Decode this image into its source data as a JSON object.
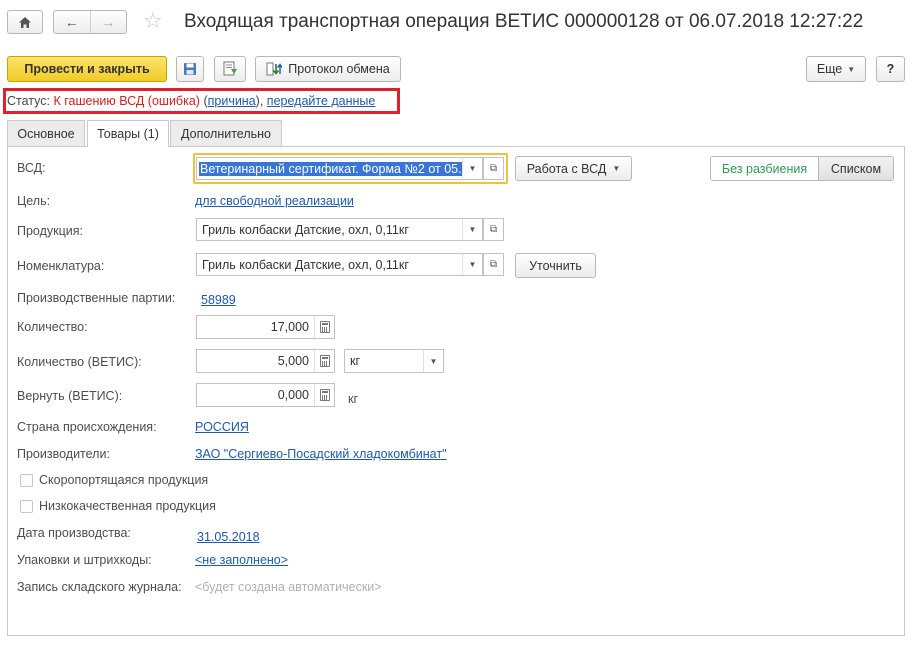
{
  "window": {
    "title": "Входящая транспортная операция ВЕТИС 000000128 от 06.07.2018 12:27:22"
  },
  "toolbar": {
    "post_close_label": "Провести и закрыть",
    "exchange_protocol_label": "Протокол обмена",
    "more_label": "Еще",
    "help_label": "?"
  },
  "status": {
    "label": "Статус:",
    "value": "К гашению ВСД (ошибка)",
    "reason_link": "причина",
    "send_link": "передайте данные"
  },
  "tabs": [
    {
      "label": "Основное"
    },
    {
      "label": "Товары (1)"
    },
    {
      "label": "Дополнительно"
    }
  ],
  "form": {
    "vsd_label": "ВСД:",
    "vsd_value": "Ветеринарный сертификат. Форма №2 от 05.",
    "vsd_work_label": "Работа с ВСД",
    "no_split_label": "Без разбиения",
    "list_label": "Списком",
    "purpose_label": "Цель:",
    "purpose_value": "для свободной реализации",
    "product_label": "Продукция:",
    "product_value": "Гриль колбаски Датские, охл, 0,11кг",
    "nomenclature_label": "Номенклатура:",
    "nomenclature_value": "Гриль колбаски Датские, охл, 0,11кг",
    "refine_label": "Уточнить",
    "batches_label": "Производственные партии:",
    "batches_value": "58989",
    "qty_label": "Количество:",
    "qty_value": "17,000",
    "qty_vetis_label": "Количество (ВЕТИС):",
    "qty_vetis_value": "5,000",
    "unit_value": "кг",
    "return_label": "Вернуть (ВЕТИС):",
    "return_value": "0,000",
    "return_unit": "кг",
    "country_label": "Страна происхождения:",
    "country_value": "РОССИЯ",
    "producers_label": "Производители:",
    "producers_value": "ЗАО \"Сергиево-Посадский хладокомбинат\"",
    "perishable_label": "Скоропортящаяся продукция",
    "lowquality_label": "Низкокачественная продукция",
    "prod_date_label": "Дата производства:",
    "prod_date_value": "31.05.2018",
    "packaging_label": "Упаковки и штрихкоды:",
    "packaging_value": "<не заполнено>",
    "journal_label": "Запись складского журнала:",
    "journal_value": "<будет создана автоматически>"
  },
  "colors": {
    "primary_button": "#f5d338",
    "status_red": "#d22020",
    "link_blue": "#1e5aa8",
    "highlight_box": "#e0202a",
    "focus_border": "#f0c040",
    "selection": "#3875d7",
    "green_text": "#2f9a54"
  }
}
